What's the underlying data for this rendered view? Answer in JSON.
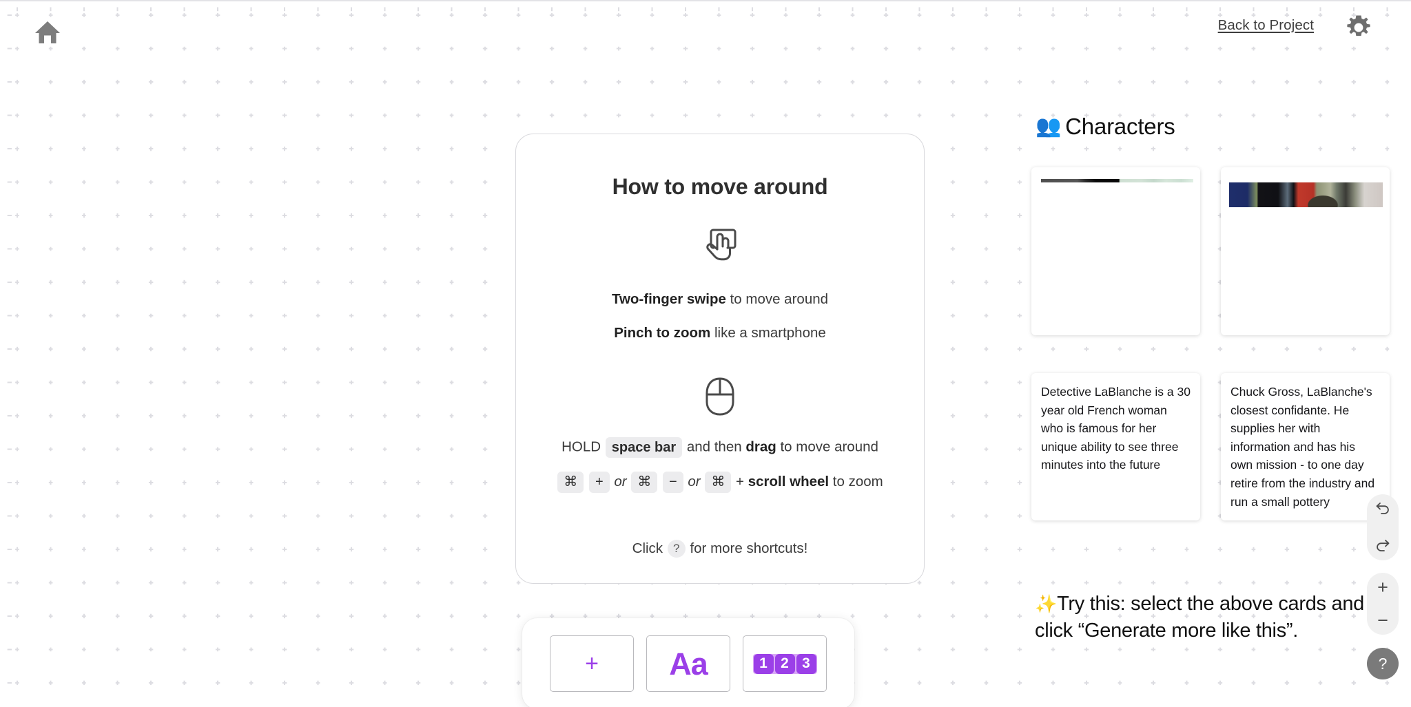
{
  "topbar": {
    "home_icon": "home-icon",
    "back_link": "Back to Project",
    "settings_icon": "gear-icon"
  },
  "howto_card": {
    "title": "How to move around",
    "gesture_icon": "two-finger-swipe-icon",
    "mouse_icon": "mouse-icon",
    "swipe_line": {
      "bold": "Two-finger swipe",
      "rest": " to move around"
    },
    "pinch_line": {
      "bold": "Pinch to zoom",
      "rest": " like a smartphone"
    },
    "hold_line": {
      "prefix": "HOLD ",
      "key": "space bar",
      "middle": " and then ",
      "bold": "drag",
      "suffix": " to move around"
    },
    "zoom_line": {
      "cmd": "⌘",
      "plus": "+",
      "or": "or",
      "minus": "−",
      "scroll_bold": "scroll wheel",
      "plus_sep": "+",
      "suffix": " to zoom"
    },
    "shortcuts_line": {
      "prefix": "Click ",
      "key": "?",
      "suffix": " for more shortcuts!"
    }
  },
  "insert_toolbar": {
    "add_tile": "+",
    "text_tile": "Aa",
    "list_tile": [
      "1",
      "2",
      "3"
    ]
  },
  "characters": {
    "emoji": "👥",
    "heading": "Characters",
    "cards": [
      {
        "name": "character-card-lablanche",
        "text": "Detective LaBlanche is a 30 year old French woman who is famous for her unique ability to see three minutes into the future"
      },
      {
        "name": "character-card-chuck-gross",
        "text": "Chuck Gross, LaBlanche's closest confidante. He supplies her with information and has his own mission - to one day retire from the industry and run a small pottery"
      }
    ],
    "try_this": {
      "sparkle": "✨",
      "text": "Try this: select the above cards and click “Generate more like this”."
    }
  },
  "floating_controls": {
    "undo_icon": "undo-arrow-icon",
    "redo_icon": "redo-arrow-icon",
    "zoom_in": "+",
    "zoom_out": "−",
    "help": "?"
  },
  "colors": {
    "accent_purple": "#9b3fe8",
    "accent_purple_light": "#d9a8f6",
    "icon_gray": "#7a7a7a",
    "canvas_dot": "#dddde2",
    "card_border": "#d8d8dc"
  }
}
